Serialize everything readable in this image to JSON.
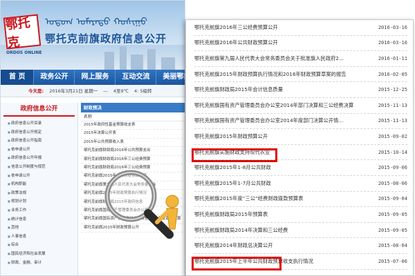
{
  "site": {
    "logo_text": "鄂托克",
    "logo_en": "ORDOS ONLINE",
    "mongolian_script": "ᠣᠲᠣᠭ ᠤᠮᠡᠷᠡᠳᠦ ᠬᠣᠰᠢᠭᠤ",
    "title": "鄂托克前旗政府信息公开",
    "nav": [
      "首 页",
      "政务公开",
      "网上服务",
      "互动交流",
      "美丽鄂前旗"
    ],
    "datebar": {
      "today_label": "今天是:",
      "date": "2016年3月21日 星期一",
      "weather_city": "—",
      "weather_temp": "4至9℃",
      "extra": "4:  5级转"
    },
    "sidebar": {
      "heading": "政府信息公开",
      "items": [
        "政府信息公开目录",
        "政府信息公开规定",
        "政府信息公开指南",
        "依申请公开",
        "政府信息公开年报",
        "信息公开制度与规范",
        "依申请公开",
        "机构职能",
        "政策法规",
        "规划计划",
        "业务工作",
        "统计信息",
        "其他",
        "人事信息",
        "综合",
        "国民经济和社会发展",
        "财政、金融、审计"
      ]
    },
    "content": {
      "section_heading": "财政预决",
      "column_header": "名称",
      "items": [
        "2015年政府性基金预算收支表",
        "2015年决算公开表",
        "2015年公共预算收入表",
        "鄂托克前旗财政局2016年公共预算支出",
        "鄂托克前旗财政局2016年三公经费预算",
        "鄂托克前旗财政局2016年三公经费预算",
        "鄂托克前旗2015年公共财政预算公开",
        "鄂托克前旗第九届人民代表大会常务委员会",
        "鄂托克前旗2015年财政预算执行情况",
        "鄂托克前旗财政局2015年政府信息",
        "鄂托克前旗国有资产管理委员会办公室",
        "鄂托克前旗国有资产管理委员会办公室2014年度部门决算",
        "鄂托克前旗2015年财政预算公开"
      ]
    }
  },
  "panel": {
    "rows": [
      {
        "title": "鄂托克前旗2016年三公经费预算公开",
        "date": "2016-03-16"
      },
      {
        "title": "鄂托克前旗2016年公共财政预算公开",
        "date": "2016-03-16"
      },
      {
        "title": "鄂托克前旗第九届人民代表大会常务委员会关于批准旗人民政府2...",
        "date": "2016-01-11"
      },
      {
        "title": "鄂托克前旗2015年财政预算执行情况和2016年财政预算草案的报告",
        "date": "2016-02-05"
      },
      {
        "title": "鄂托克前旗财政局2015年会计信息质量",
        "date": "2015-12-25"
      },
      {
        "title": "鄂托克前旗国有资产管理委员会办公室2014年部门决算和三公经费决算",
        "date": "2015-11-13"
      },
      {
        "title": "鄂托克前旗国有资产管理委员会办公室2014年度部门决算公开情...",
        "date": "2015-11-13"
      },
      {
        "title": "鄂托克前旗2015年财政预算公开",
        "date": "2015-09-02"
      },
      {
        "title": "鄂托克前旗实施财政支持现代农业",
        "date": "2015-10-14"
      },
      {
        "title": "鄂托克前旗2015年1-8月公共财政",
        "date": "2015-09-06"
      },
      {
        "title": "鄂托克前旗2015年1-7月公共财政",
        "date": "2015-08-06"
      },
      {
        "title": "鄂托克前旗2015年度“三公”经费财政拨款预算表",
        "date": "2015-09-04"
      },
      {
        "title": "鄂托克前旗财政局2015年预算表",
        "date": "2015-09-05"
      },
      {
        "title": "鄂托克前旗财政局2014年决算和三公经费",
        "date": "2015-09-05"
      },
      {
        "title": "鄂托克前旗2014年财政总决算公开",
        "date": "2015-08-04"
      },
      {
        "title": "鄂托克前旗2015年上半年公共财政预算收支执行情况",
        "date": "2015-07-06"
      }
    ]
  },
  "colors": {
    "brand_blue": "#1d5598",
    "nav_blue": "#1c56a0",
    "highlight_red": "#e10000",
    "logo_red": "#c8161d"
  }
}
